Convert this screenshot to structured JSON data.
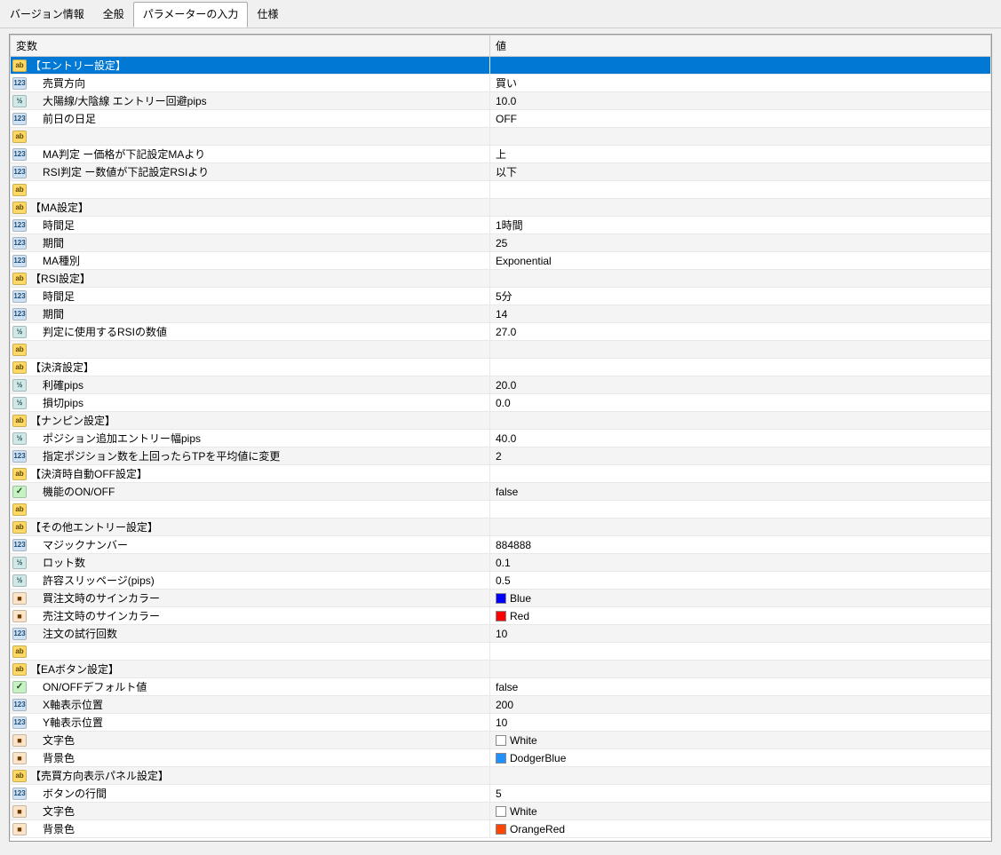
{
  "tabs": {
    "items": [
      {
        "label": "バージョン情報",
        "active": false
      },
      {
        "label": "全般",
        "active": false
      },
      {
        "label": "パラメーターの入力",
        "active": true
      },
      {
        "label": "仕様",
        "active": false
      }
    ]
  },
  "columns": {
    "variable": "変数",
    "value": "値"
  },
  "rows": [
    {
      "icon": "abc",
      "indent": 0,
      "name": "【エントリー設定】",
      "value": "",
      "selected": true
    },
    {
      "icon": "123",
      "indent": 1,
      "name": "売買方向",
      "value": "買い"
    },
    {
      "icon": "1e2",
      "indent": 1,
      "name": "大陽線/大陰線 エントリー回避pips",
      "value": "10.0"
    },
    {
      "icon": "123",
      "indent": 1,
      "name": "前日の日足",
      "value": "OFF"
    },
    {
      "icon": "abc",
      "indent": 0,
      "name": "",
      "value": ""
    },
    {
      "icon": "123",
      "indent": 1,
      "name": "MA判定 ー価格が下記設定MAより",
      "value": "上"
    },
    {
      "icon": "123",
      "indent": 1,
      "name": "RSI判定 ー数値が下記設定RSIより",
      "value": "以下"
    },
    {
      "icon": "abc",
      "indent": 0,
      "name": "",
      "value": ""
    },
    {
      "icon": "abc",
      "indent": 0,
      "name": "【MA設定】",
      "value": ""
    },
    {
      "icon": "123",
      "indent": 1,
      "name": "時間足",
      "value": "1時間"
    },
    {
      "icon": "123",
      "indent": 1,
      "name": "期間",
      "value": "25"
    },
    {
      "icon": "123",
      "indent": 1,
      "name": "MA種別",
      "value": "Exponential"
    },
    {
      "icon": "abc",
      "indent": 0,
      "name": "【RSI設定】",
      "value": ""
    },
    {
      "icon": "123",
      "indent": 1,
      "name": "時間足",
      "value": "5分"
    },
    {
      "icon": "123",
      "indent": 1,
      "name": "期間",
      "value": "14"
    },
    {
      "icon": "1e2",
      "indent": 1,
      "name": "判定に使用するRSIの数値",
      "value": "27.0"
    },
    {
      "icon": "abc",
      "indent": 0,
      "name": "",
      "value": ""
    },
    {
      "icon": "abc",
      "indent": 0,
      "name": "【決済設定】",
      "value": ""
    },
    {
      "icon": "1e2",
      "indent": 1,
      "name": "利確pips",
      "value": "20.0"
    },
    {
      "icon": "1e2",
      "indent": 1,
      "name": "損切pips",
      "value": "0.0"
    },
    {
      "icon": "abc",
      "indent": 0,
      "name": "【ナンピン設定】",
      "value": ""
    },
    {
      "icon": "1e2",
      "indent": 1,
      "name": "ポジション追加エントリー幅pips",
      "value": "40.0"
    },
    {
      "icon": "123",
      "indent": 1,
      "name": "指定ポジション数を上回ったらTPを平均値に変更",
      "value": "2"
    },
    {
      "icon": "abc",
      "indent": 0,
      "name": "【決済時自動OFF設定】",
      "value": ""
    },
    {
      "icon": "bool",
      "indent": 1,
      "name": "機能のON/OFF",
      "value": "false"
    },
    {
      "icon": "abc",
      "indent": 0,
      "name": "",
      "value": ""
    },
    {
      "icon": "abc",
      "indent": 0,
      "name": "【その他エントリー設定】",
      "value": ""
    },
    {
      "icon": "123",
      "indent": 1,
      "name": "マジックナンバー",
      "value": "884888"
    },
    {
      "icon": "1e2",
      "indent": 1,
      "name": "ロット数",
      "value": "0.1"
    },
    {
      "icon": "1e2",
      "indent": 1,
      "name": "許容スリッページ(pips)",
      "value": "0.5"
    },
    {
      "icon": "color",
      "indent": 1,
      "name": "買注文時のサインカラー",
      "value": "Blue",
      "swatch": "#0000ff"
    },
    {
      "icon": "color",
      "indent": 1,
      "name": "売注文時のサインカラー",
      "value": "Red",
      "swatch": "#ff0000"
    },
    {
      "icon": "123",
      "indent": 1,
      "name": "注文の試行回数",
      "value": "10"
    },
    {
      "icon": "abc",
      "indent": 0,
      "name": "",
      "value": ""
    },
    {
      "icon": "abc",
      "indent": 0,
      "name": "【EAボタン設定】",
      "value": ""
    },
    {
      "icon": "bool",
      "indent": 1,
      "name": "ON/OFFデフォルト値",
      "value": "false"
    },
    {
      "icon": "123",
      "indent": 1,
      "name": "X軸表示位置",
      "value": "200"
    },
    {
      "icon": "123",
      "indent": 1,
      "name": "Y軸表示位置",
      "value": "10"
    },
    {
      "icon": "color",
      "indent": 1,
      "name": "文字色",
      "value": "White",
      "swatch": "#ffffff"
    },
    {
      "icon": "color",
      "indent": 1,
      "name": "背景色",
      "value": "DodgerBlue",
      "swatch": "#1e90ff"
    },
    {
      "icon": "abc",
      "indent": 0,
      "name": "【売買方向表示パネル設定】",
      "value": ""
    },
    {
      "icon": "123",
      "indent": 1,
      "name": "ボタンの行間",
      "value": "5"
    },
    {
      "icon": "color",
      "indent": 1,
      "name": "文字色",
      "value": "White",
      "swatch": "#ffffff"
    },
    {
      "icon": "color",
      "indent": 1,
      "name": "背景色",
      "value": "OrangeRed",
      "swatch": "#ff4500"
    }
  ],
  "iconLabels": {
    "abc": "ab",
    "123": "123",
    "1e2": "½",
    "bool": "✓",
    "color": "■"
  }
}
